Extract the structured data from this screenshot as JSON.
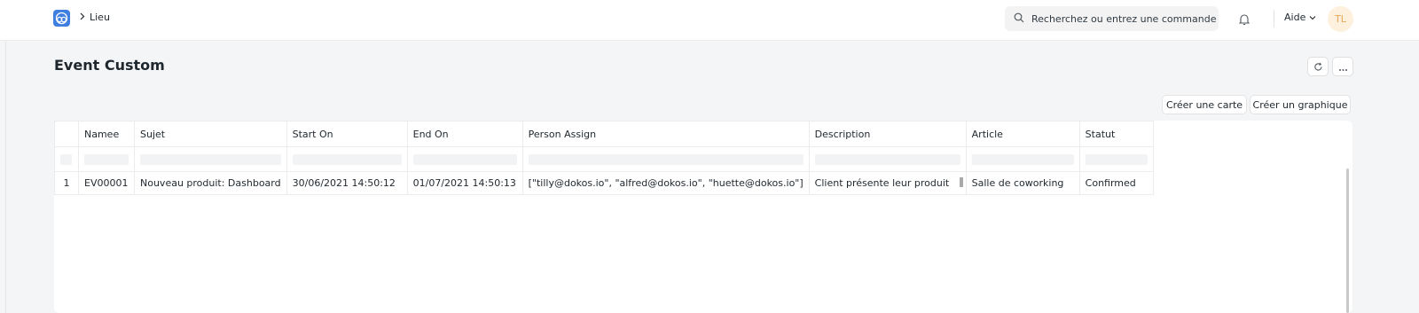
{
  "navbar": {
    "breadcrumb": "Lieu",
    "search_placeholder": "Recherchez ou entrez une commande",
    "help_label": "Aide",
    "avatar_initials": "TL"
  },
  "page": {
    "title": "Event Custom"
  },
  "actions": {
    "create_card": "Créer une carte",
    "create_chart": "Créer un graphique"
  },
  "table": {
    "columns": [
      "Namee",
      "Sujet",
      "Start On",
      "End On",
      "Person Assign",
      "Description",
      "Article",
      "Statut"
    ],
    "rows": [
      {
        "index": "1",
        "namee": "EV00001",
        "sujet": "Nouveau produit: Dashboard",
        "start_on": "30/06/2021 14:50:12",
        "end_on": "01/07/2021 14:50:13",
        "person_assign": "[\"tilly@dokos.io\", \"alfred@dokos.io\", \"huette@dokos.io\"]",
        "description": "Client présente leur produit",
        "article": "Salle de coworking",
        "statut": "Confirmed"
      }
    ]
  },
  "colors": {
    "accent": "#3f7fe0",
    "background": "#f4f5f6",
    "avatar_bg": "#fdf0dc",
    "avatar_text": "#e3a85b"
  }
}
